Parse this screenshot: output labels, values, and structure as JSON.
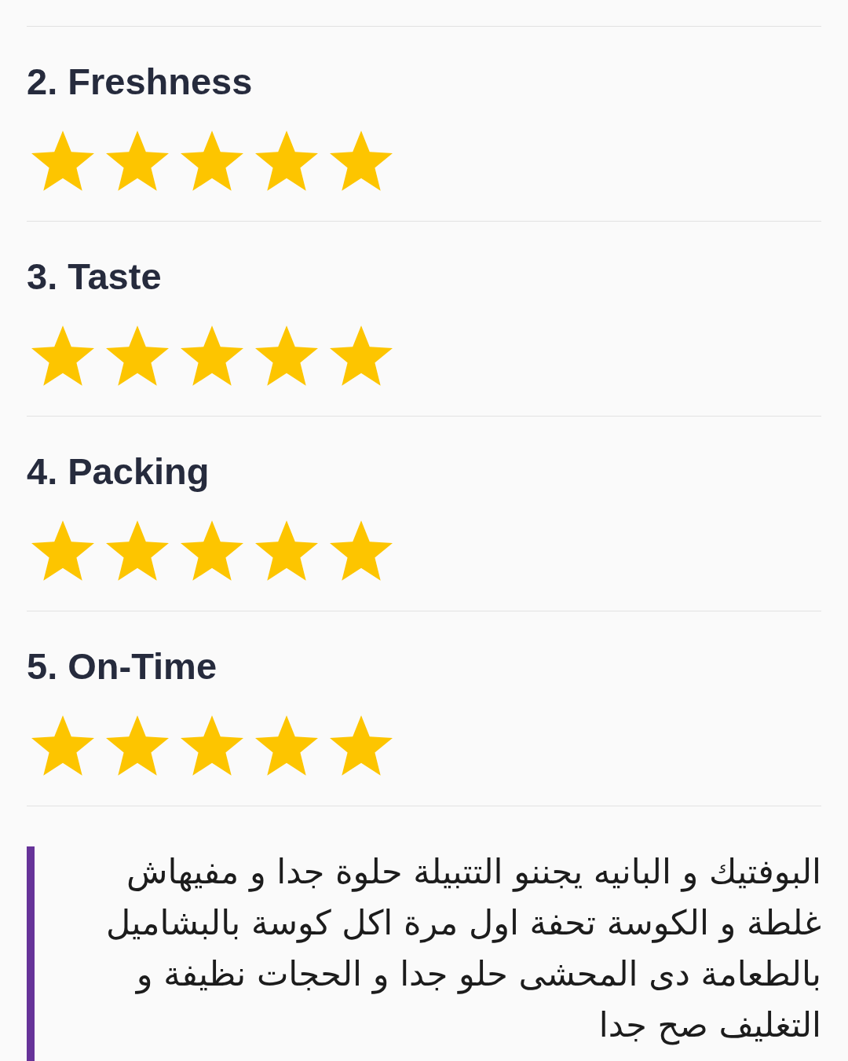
{
  "ratings": [
    {
      "label": "2. Freshness",
      "stars": 5
    },
    {
      "label": "3. Taste",
      "stars": 5
    },
    {
      "label": "4. Packing",
      "stars": 5
    },
    {
      "label": "5. On-Time",
      "stars": 5
    }
  ],
  "review": {
    "text": "البوفتيك و البانيه يجننو التتبيلة حلوة جدا و مفيهاش غلطة و الكوسة تحفة اول مرة اكل كوسة بالبشاميل بالطعامة دى المحشى حلو جدا و الحجات نظيفة و التغليف صح جدا"
  }
}
